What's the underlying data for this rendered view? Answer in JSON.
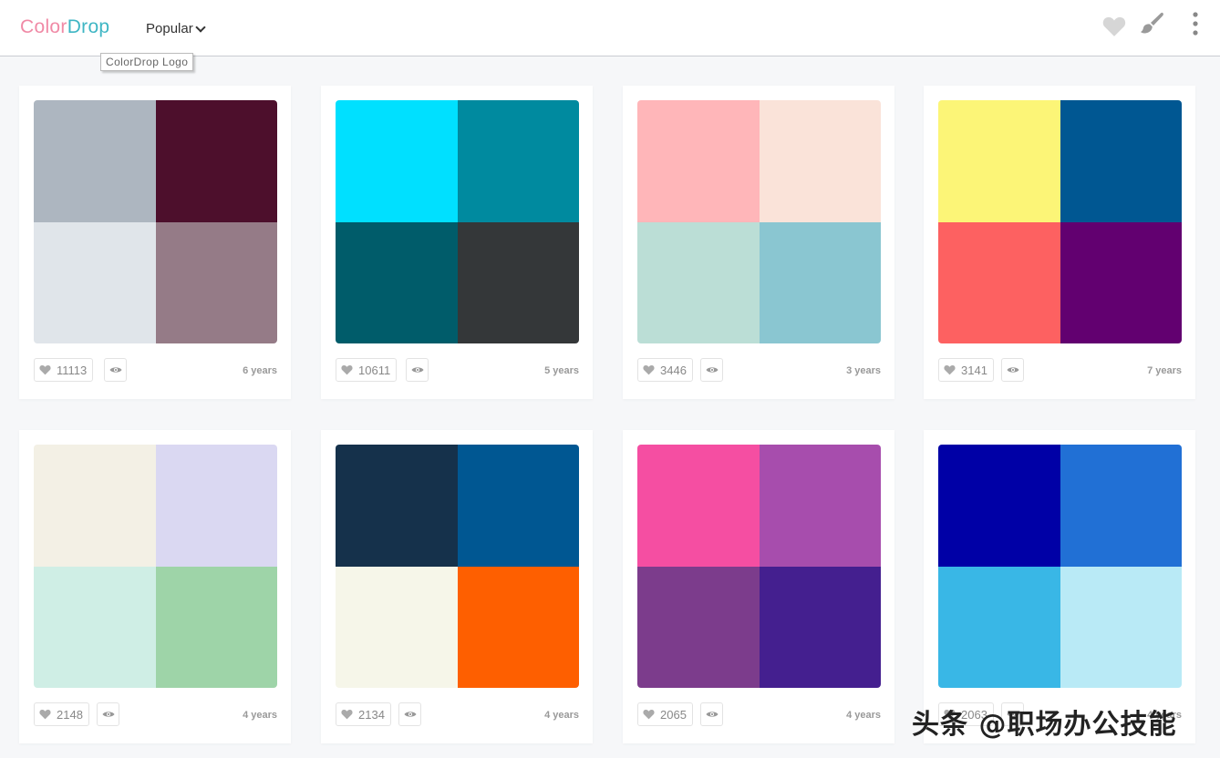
{
  "header": {
    "logo_part1": "Color",
    "logo_part2": "Drop",
    "logo_tooltip": "ColorDrop Logo",
    "menu_label": "Popular"
  },
  "palettes": [
    {
      "colors": [
        "#adb6c0",
        "#4d0f2c",
        "#e0e5ea",
        "#957b87"
      ],
      "likes": "11113",
      "age": "6 years"
    },
    {
      "colors": [
        "#00e0ff",
        "#008a9f",
        "#005c6a",
        "#343739"
      ],
      "likes": "10611",
      "age": "5 years"
    },
    {
      "colors": [
        "#ffb6b9",
        "#fae3d9",
        "#bbded6",
        "#8ac6d1"
      ],
      "likes": "3446",
      "age": "3 years"
    },
    {
      "colors": [
        "#fcf577",
        "#005792",
        "#fd6161",
        "#620070"
      ],
      "likes": "3141",
      "age": "7 years"
    },
    {
      "colors": [
        "#f3f0e5",
        "#dad8f2",
        "#cfeee5",
        "#9ed4a8"
      ],
      "likes": "2148",
      "age": "4 years"
    },
    {
      "colors": [
        "#15314b",
        "#005792",
        "#f6f6e9",
        "#fe5f00"
      ],
      "likes": "2134",
      "age": "4 years"
    },
    {
      "colors": [
        "#f54ea2",
        "#a74dad",
        "#7c3c8c",
        "#441f8f"
      ],
      "likes": "2065",
      "age": "4 years"
    },
    {
      "colors": [
        "#0000a6",
        "#2170d5",
        "#39b7e6",
        "#b9eaf6"
      ],
      "likes": "2063",
      "age": "4 years"
    }
  ],
  "watermark": "头条 @职场办公技能"
}
